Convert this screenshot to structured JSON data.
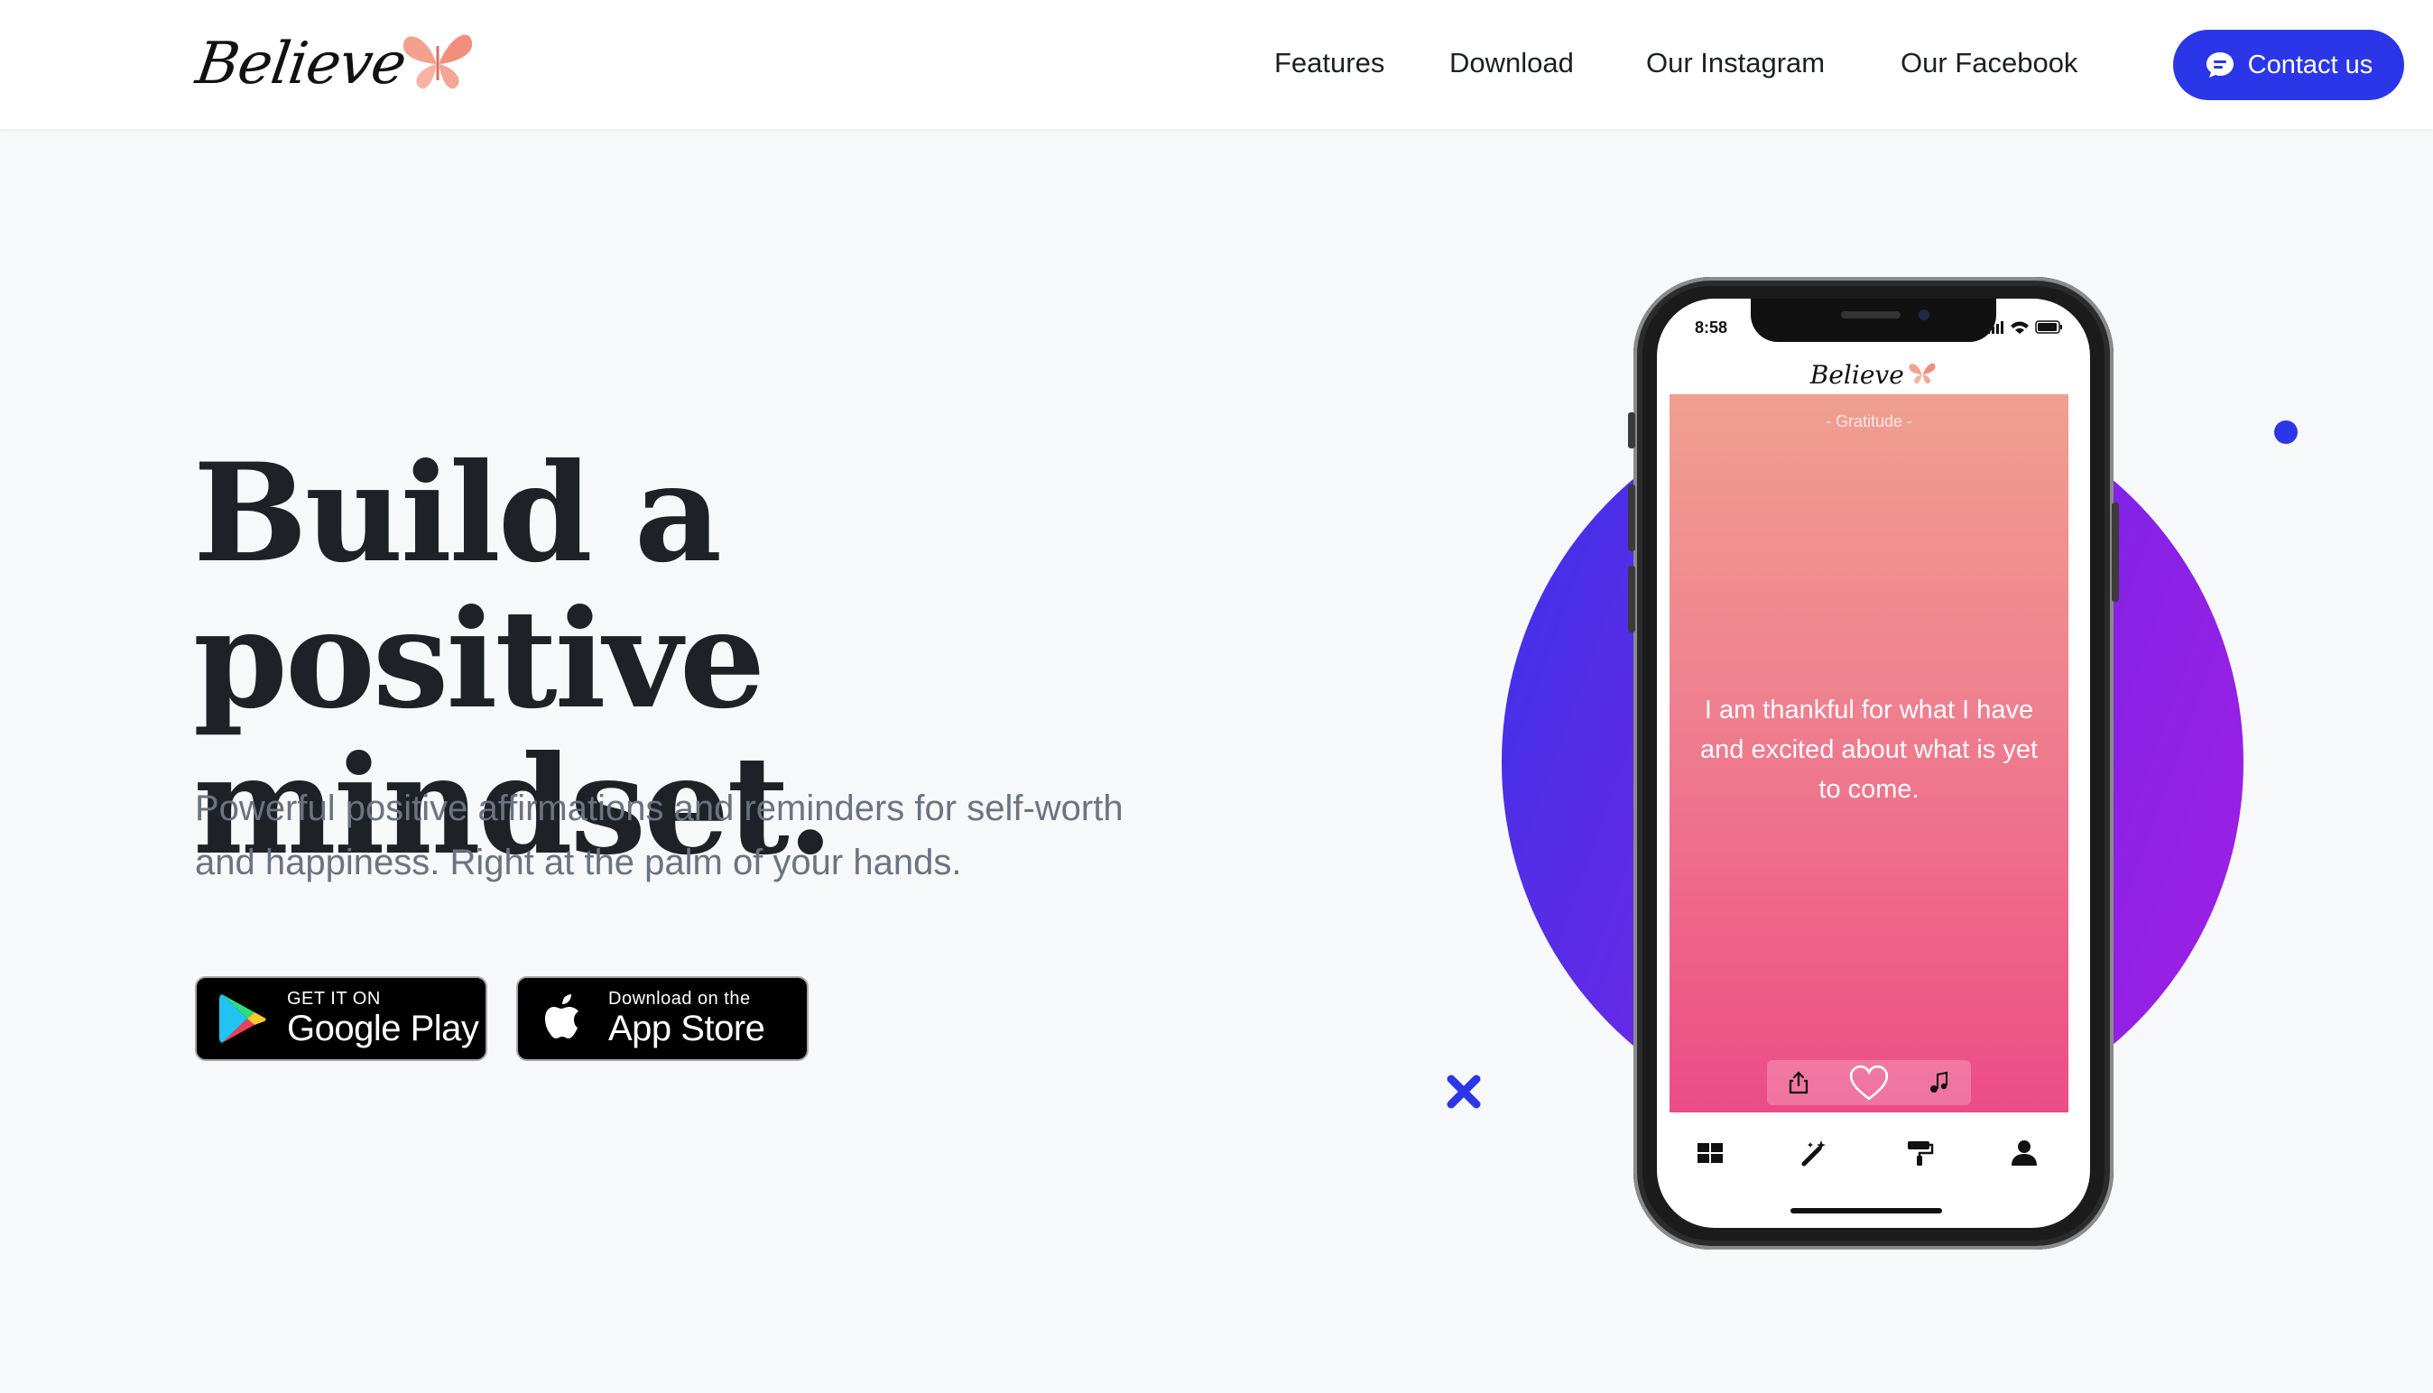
{
  "nav": {
    "brand": "Believe",
    "links": [
      "Features",
      "Download",
      "Our Instagram",
      "Our Facebook"
    ],
    "contact_label": "Contact us"
  },
  "hero": {
    "headline_line1": "Build a positive",
    "headline_line2": "mindset.",
    "subtitle_line1": "Powerful positive affirmations and reminders for self-worth",
    "subtitle_line2": "and happiness. Right at the palm of your hands."
  },
  "badges": {
    "google_small": "GET IT ON",
    "google_large": "Google Play",
    "apple_small": "Download on the",
    "apple_large": "App Store"
  },
  "phone": {
    "time": "8:58",
    "app_brand": "Believe",
    "category": "- Gratitude -",
    "quote": "I am thankful for what I have and excited about what is yet to come."
  },
  "colors": {
    "accent": "#2a36e8",
    "circle_start": "#3b33e8",
    "circle_end": "#a21fe3",
    "card_top": "#f09f90",
    "card_bottom": "#ec4c86",
    "butterfly": "#f4a08e"
  },
  "icons": [
    "butterfly-icon",
    "chat-bubble-icon",
    "google-play-icon",
    "apple-icon",
    "share-icon",
    "heart-icon",
    "music-note-icon",
    "grid-icon",
    "magic-wand-icon",
    "paint-roller-icon",
    "user-icon"
  ]
}
